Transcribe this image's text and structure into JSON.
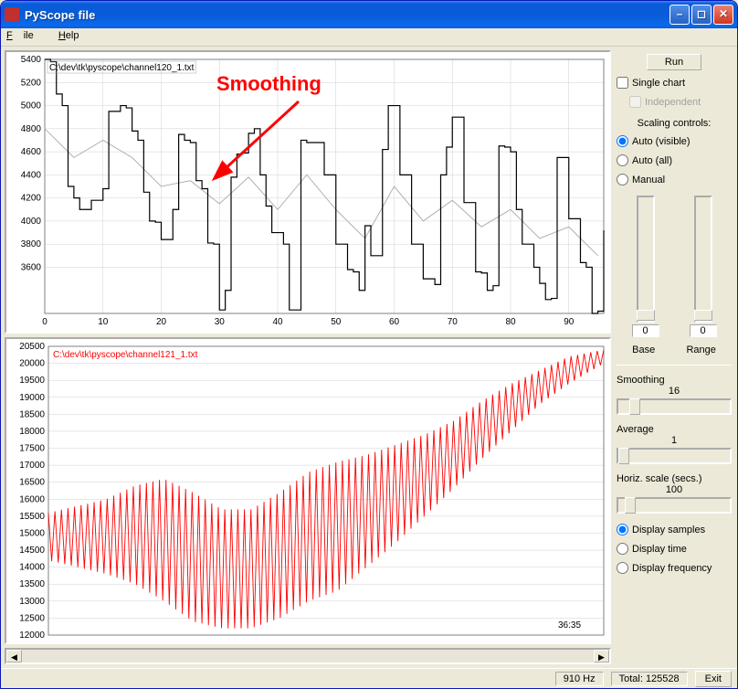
{
  "window": {
    "title": "PyScope file"
  },
  "menu": {
    "file": "File",
    "help": "Help"
  },
  "sidebar": {
    "run": "Run",
    "single_chart": "Single chart",
    "independent": "Independent",
    "scaling_label": "Scaling controls:",
    "auto_visible": "Auto (visible)",
    "auto_all": "Auto (all)",
    "manual": "Manual",
    "base_val": "0",
    "range_val": "0",
    "base_label": "Base",
    "range_label": "Range",
    "smoothing_label": "Smoothing",
    "smoothing_val": "16",
    "average_label": "Average",
    "average_val": "1",
    "hscale_label": "Horiz. scale (secs.)",
    "hscale_val": "100",
    "display_samples": "Display samples",
    "display_time": "Display time",
    "display_frequency": "Display frequency"
  },
  "status": {
    "rate": "910 Hz",
    "total": "Total: 125528",
    "exit": "Exit"
  },
  "annotation": {
    "text": "Smoothing"
  },
  "chart1": {
    "title": "C:\\dev\\tk\\pyscope\\channel120_1.txt",
    "timestamp": ""
  },
  "chart2": {
    "title": "C:\\dev\\tk\\pyscope\\channel121_1.txt",
    "timestamp": "36:35"
  },
  "chart_data": [
    {
      "type": "line",
      "title": "C:\\dev\\tk\\pyscope\\channel120_1.txt",
      "xlabel": "",
      "ylabel": "",
      "xlim": [
        0,
        96
      ],
      "ylim": [
        3200,
        5400
      ],
      "xticks": [
        0,
        10,
        20,
        30,
        40,
        50,
        60,
        70,
        80,
        90
      ],
      "yticks": [
        3600,
        3800,
        4000,
        4200,
        4400,
        4600,
        4800,
        5000,
        5200,
        5400
      ],
      "series": [
        {
          "name": "raw",
          "color": "#000000",
          "x": [
            0,
            1,
            2,
            3,
            4,
            5,
            6,
            7,
            8,
            9,
            10,
            11,
            12,
            13,
            14,
            15,
            16,
            17,
            18,
            19,
            20,
            21,
            22,
            23,
            24,
            25,
            26,
            27,
            28,
            29,
            30,
            31,
            32,
            33,
            34,
            35,
            36,
            37,
            38,
            39,
            40,
            41,
            42,
            43,
            44,
            45,
            46,
            47,
            48,
            49,
            50,
            51,
            52,
            53,
            54,
            55,
            56,
            57,
            58,
            59,
            60,
            61,
            62,
            63,
            64,
            65,
            66,
            67,
            68,
            69,
            70,
            71,
            72,
            73,
            74,
            75,
            76,
            77,
            78,
            79,
            80,
            81,
            82,
            83,
            84,
            85,
            86,
            87,
            88,
            89,
            90,
            91,
            92,
            93,
            94,
            95,
            96
          ],
          "y": [
            5400,
            5380,
            5100,
            5000,
            4300,
            4200,
            4100,
            4100,
            4180,
            4180,
            4280,
            4950,
            4950,
            5000,
            4980,
            4780,
            4700,
            4250,
            4000,
            3990,
            3840,
            3840,
            4100,
            4750,
            4700,
            4680,
            4350,
            4280,
            3810,
            3800,
            3230,
            3400,
            4380,
            4580,
            4590,
            4760,
            4800,
            4400,
            4130,
            3900,
            3900,
            3800,
            3230,
            3230,
            4700,
            4680,
            4680,
            4680,
            4400,
            4400,
            3800,
            3800,
            3580,
            3560,
            3400,
            3960,
            3700,
            3700,
            4620,
            5000,
            5000,
            4400,
            4400,
            3800,
            3800,
            3500,
            3500,
            3450,
            4400,
            4640,
            4900,
            4900,
            4160,
            4160,
            3560,
            3550,
            3400,
            3440,
            4650,
            4640,
            4600,
            4100,
            3800,
            3800,
            3600,
            3460,
            3320,
            3330,
            4550,
            4550,
            4020,
            4020,
            3640,
            3600,
            3200,
            3220,
            3920
          ]
        },
        {
          "name": "smoothed",
          "color": "#b0b0b0",
          "x": [
            0,
            5,
            10,
            15,
            20,
            25,
            30,
            35,
            40,
            45,
            50,
            55,
            60,
            65,
            70,
            75,
            80,
            85,
            90,
            95
          ],
          "y": [
            4800,
            4550,
            4700,
            4550,
            4300,
            4350,
            4150,
            4380,
            4100,
            4400,
            4100,
            3850,
            4300,
            4000,
            4180,
            3950,
            4100,
            3850,
            3950,
            3700
          ]
        }
      ]
    },
    {
      "type": "line",
      "title": "C:\\dev\\tk\\pyscope\\channel121_1.txt",
      "xlabel": "",
      "ylabel": "",
      "xlim": [
        0,
        96
      ],
      "ylim": [
        12000,
        20500
      ],
      "yticks": [
        12000,
        12500,
        13000,
        13500,
        14000,
        14500,
        15000,
        15500,
        16000,
        16500,
        17000,
        17500,
        18000,
        18500,
        19000,
        19500,
        20000,
        20500
      ],
      "series": [
        {
          "name": "raw",
          "color": "#ff0000",
          "envelope_x": [
            0,
            5,
            10,
            15,
            20,
            25,
            30,
            35,
            40,
            45,
            50,
            55,
            60,
            65,
            70,
            75,
            80,
            85,
            90,
            96
          ],
          "envelope_low": [
            14200,
            14000,
            13800,
            13500,
            13000,
            12400,
            12200,
            12200,
            12500,
            13000,
            13300,
            14000,
            14700,
            15500,
            16300,
            17200,
            18000,
            18800,
            19400,
            20000
          ],
          "envelope_high": [
            15600,
            15800,
            16000,
            16400,
            16600,
            16200,
            15700,
            15700,
            16200,
            16800,
            17100,
            17300,
            17600,
            17900,
            18300,
            18900,
            19400,
            19800,
            20200,
            20400
          ],
          "oscillation_cycles": 85
        }
      ]
    }
  ]
}
